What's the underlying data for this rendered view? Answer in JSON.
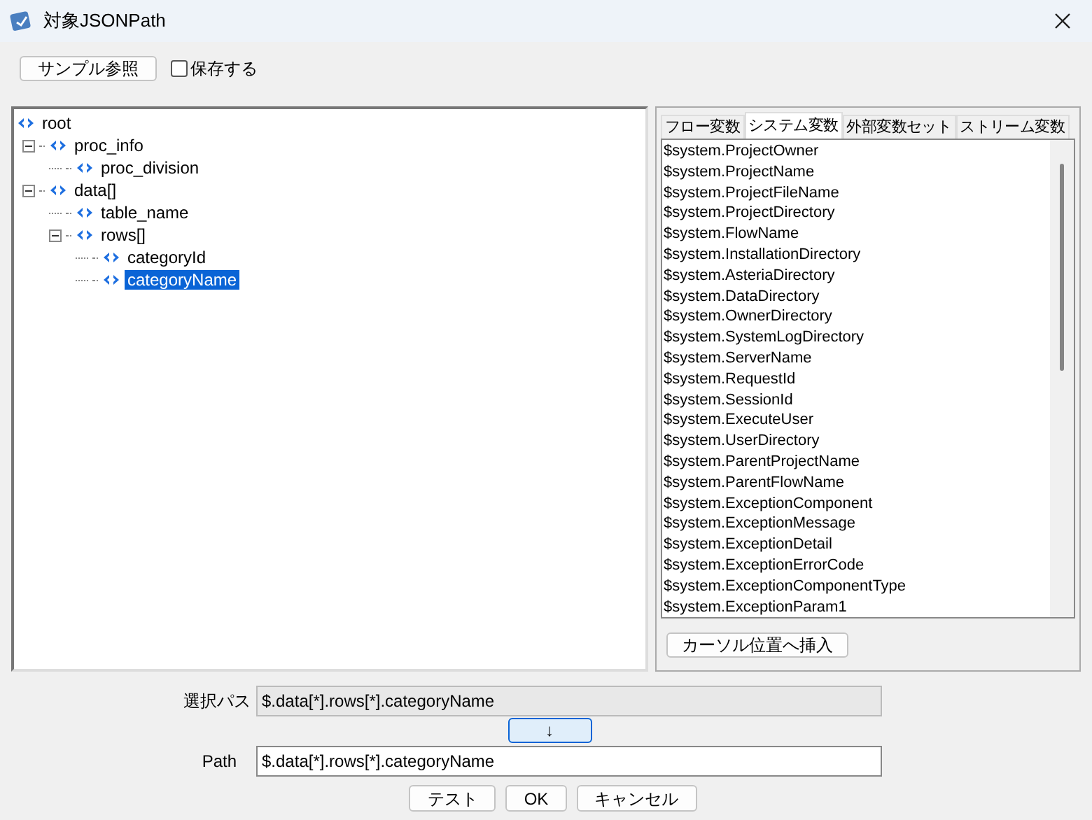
{
  "window": {
    "title": "対象JSONPath"
  },
  "toolbar": {
    "sample_button": "サンプル参照",
    "save_checkbox": {
      "label": "保存する",
      "checked": false
    }
  },
  "tree": [
    {
      "label": "root",
      "selected": false,
      "children": [
        {
          "label": "proc_info",
          "expanded": true,
          "selected": false,
          "children": [
            {
              "label": "proc_division",
              "expanded": false,
              "selected": false
            }
          ]
        },
        {
          "label": "data[]",
          "expanded": true,
          "selected": false,
          "children": [
            {
              "label": "table_name",
              "expanded": false,
              "selected": false
            },
            {
              "label": "rows[]",
              "expanded": true,
              "selected": false,
              "children": [
                {
                  "label": "categoryId",
                  "expanded": false,
                  "selected": false
                },
                {
                  "label": "categoryName",
                  "expanded": false,
                  "selected": true
                }
              ]
            }
          ]
        }
      ]
    }
  ],
  "tabs": [
    {
      "label": "フロー変数",
      "selected": false
    },
    {
      "label": "システム変数",
      "selected": true
    },
    {
      "label": "外部変数セット",
      "selected": false
    },
    {
      "label": "ストリーム変数",
      "selected": false
    }
  ],
  "variables": [
    "$system.ProjectOwner",
    "$system.ProjectName",
    "$system.ProjectFileName",
    "$system.ProjectDirectory",
    "$system.FlowName",
    "$system.InstallationDirectory",
    "$system.AsteriaDirectory",
    "$system.DataDirectory",
    "$system.OwnerDirectory",
    "$system.SystemLogDirectory",
    "$system.ServerName",
    "$system.RequestId",
    "$system.SessionId",
    "$system.ExecuteUser",
    "$system.UserDirectory",
    "$system.ParentProjectName",
    "$system.ParentFlowName",
    "$system.ExceptionComponent",
    "$system.ExceptionMessage",
    "$system.ExceptionDetail",
    "$system.ExceptionErrorCode",
    "$system.ExceptionComponentType",
    "$system.ExceptionParam1"
  ],
  "insert_button": "カーソル位置へ挿入",
  "selected_path": {
    "label": "選択パス",
    "value": "$.data[*].rows[*].categoryName"
  },
  "copy_button": "↓",
  "path": {
    "label": "Path",
    "value": "$.data[*].rows[*].categoryName"
  },
  "buttons": [
    "テスト",
    "OK",
    "キャンセル"
  ]
}
